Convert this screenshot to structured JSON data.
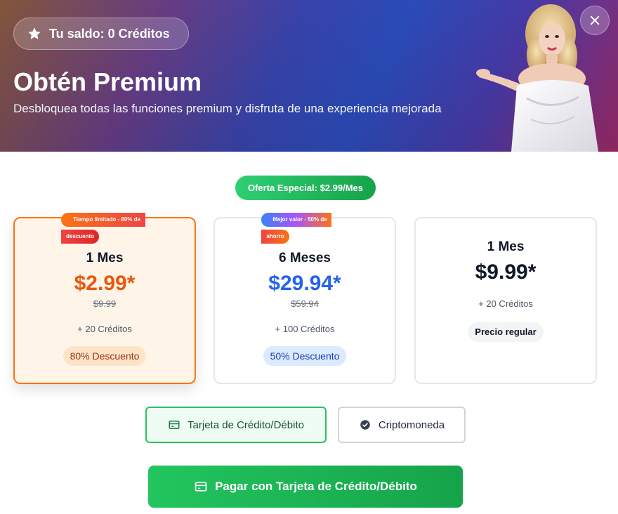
{
  "header": {
    "balance_label": "Tu saldo: 0 Créditos",
    "title": "Obtén Premium",
    "subtitle": "Desbloquea todas las funciones premium y disfruta de una experiencia mejorada",
    "close_icon": "close-icon",
    "star_icon": "star-icon"
  },
  "offer": {
    "label": "Oferta Especial: $2.99/Mes"
  },
  "plans": [
    {
      "ribbon_line1": "Tiempo limitado - 80% de",
      "ribbon_line2": "descuento",
      "name": "1 Mes",
      "price": "$2.99*",
      "old_price": "$9.99",
      "credits": "+ 20 Créditos",
      "badge": "80% Descuento",
      "selected": true
    },
    {
      "ribbon_line1": "Mejor valor - 50% de",
      "ribbon_line2": "ahorro",
      "name": "6 Meses",
      "price": "$29.94*",
      "old_price": "$59.94",
      "credits": "+ 100 Créditos",
      "badge": "50% Descuento",
      "selected": false
    },
    {
      "name": "1 Mes",
      "price": "$9.99*",
      "credits": "+ 20 Créditos",
      "badge": "Precio regular",
      "selected": false
    }
  ],
  "payment_methods": {
    "card_label": "Tarjeta de Crédito/Débito",
    "card_icon": "credit-card-icon",
    "crypto_label": "Criptomoneda",
    "crypto_icon": "check-circle-icon",
    "selected": "card"
  },
  "pay_button": {
    "label": "Pagar con Tarjeta de Crédito/Débito",
    "icon": "credit-card-icon"
  },
  "colors": {
    "accent_green": "#22c55e",
    "orange": "#ea580c",
    "blue": "#2563eb"
  }
}
